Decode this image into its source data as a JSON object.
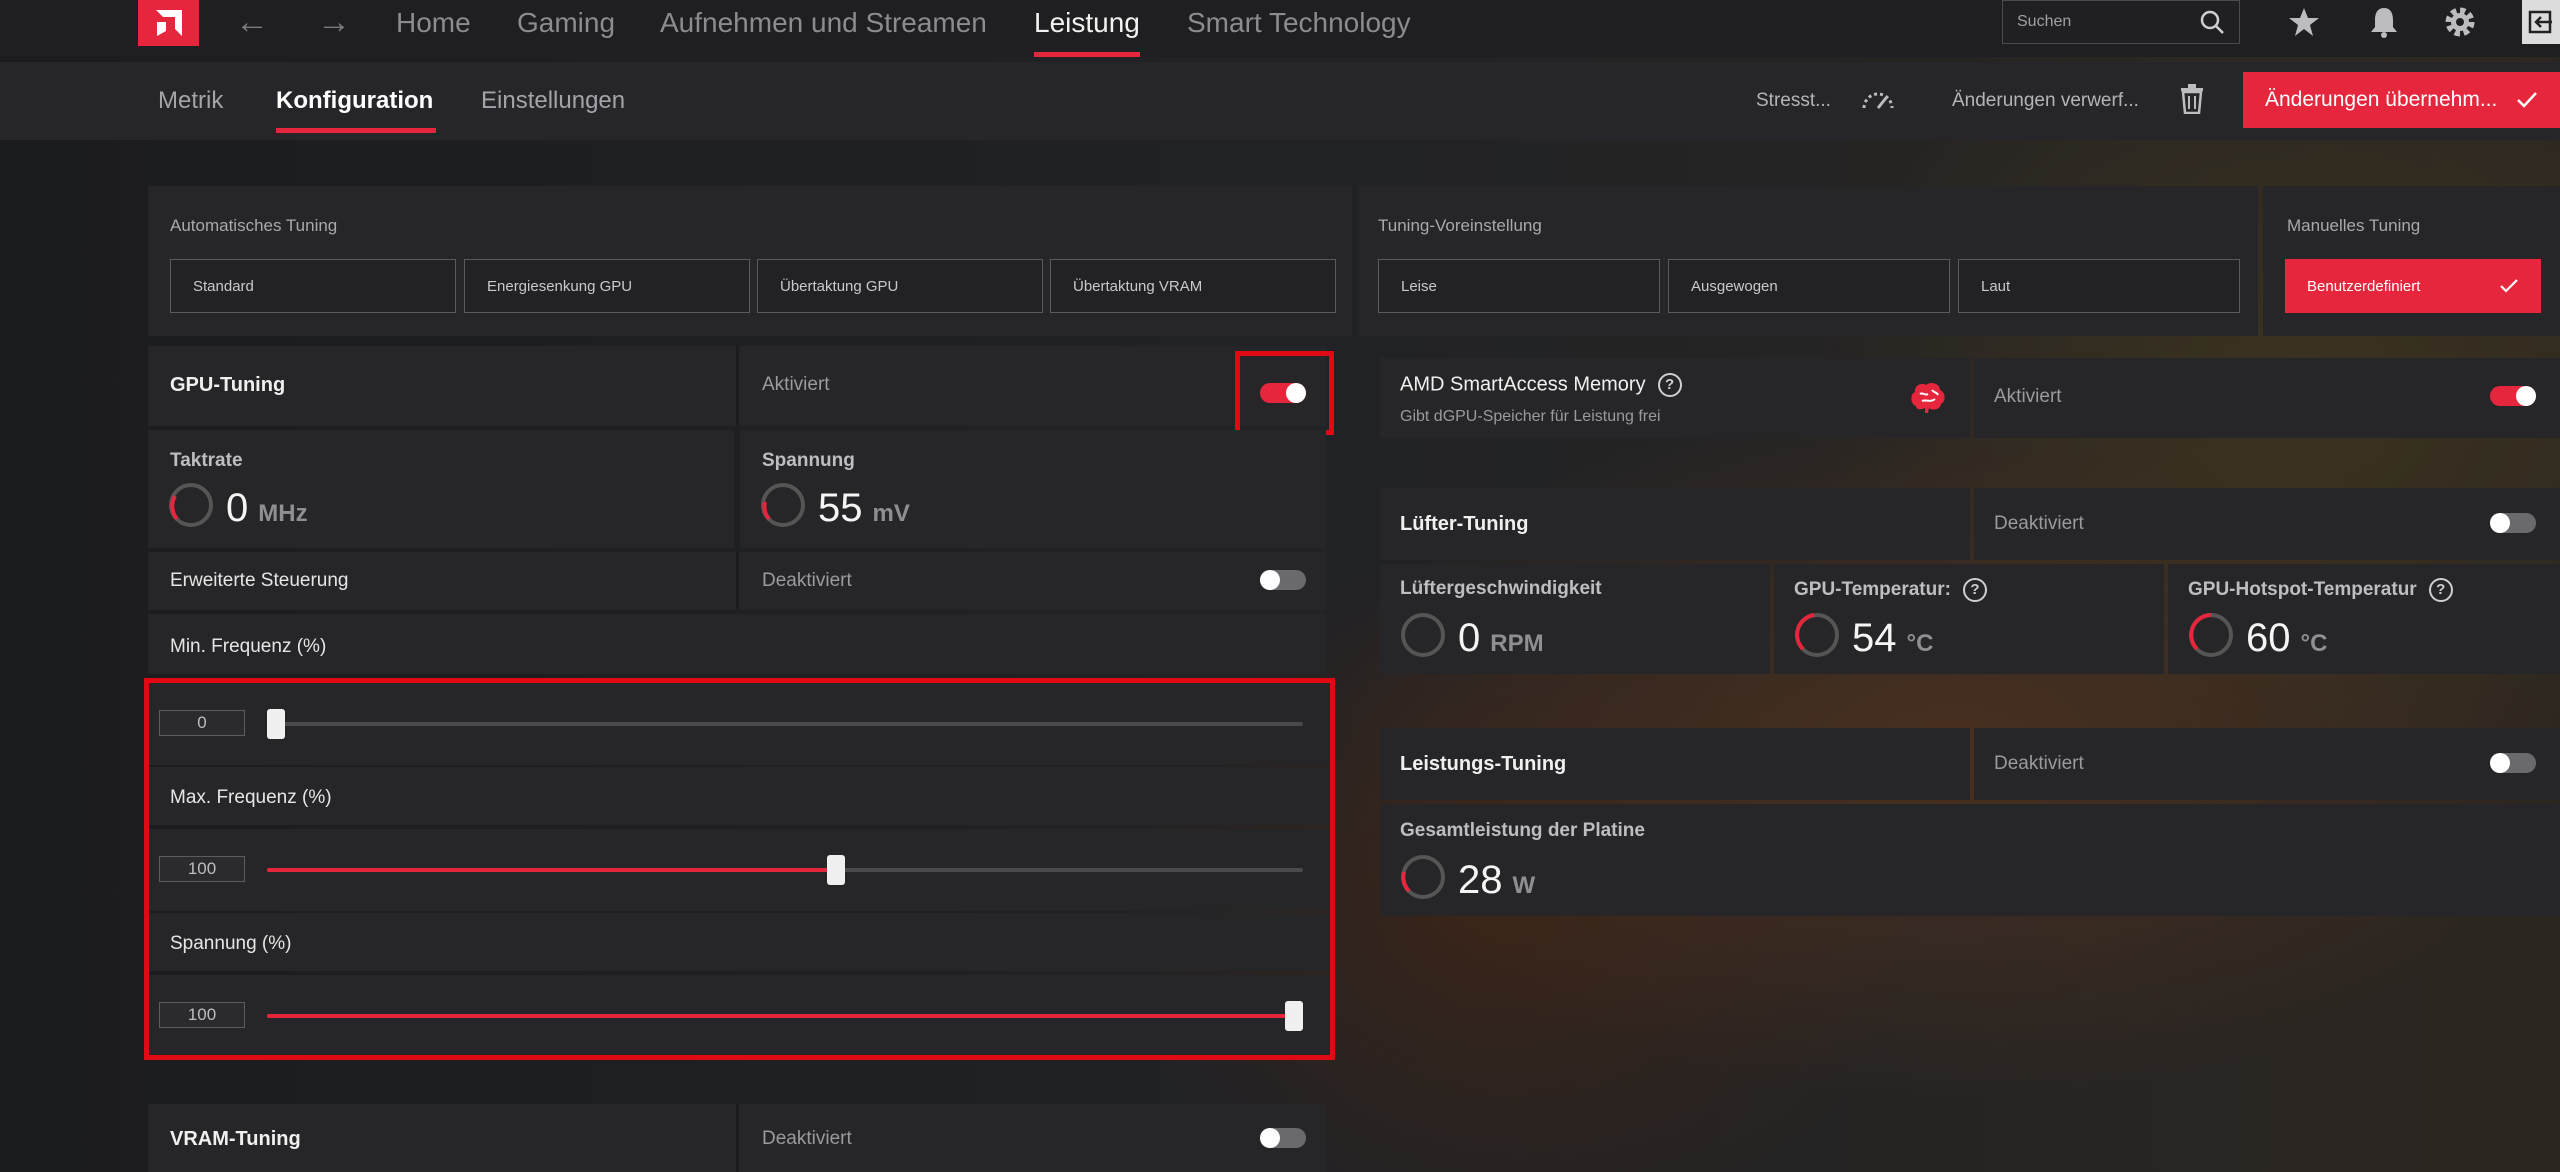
{
  "nav": {
    "tabs": [
      "Home",
      "Gaming",
      "Aufnehmen und Streamen",
      "Leistung",
      "Smart Technology"
    ],
    "active": "Leistung"
  },
  "search": {
    "placeholder": "Suchen"
  },
  "subnav": {
    "tabs": [
      "Metrik",
      "Konfiguration",
      "Einstellungen"
    ],
    "active": "Konfiguration",
    "stress": "Stresst...",
    "discard": "Änderungen verwerf...",
    "apply": "Änderungen übernehm..."
  },
  "auto_tuning": {
    "label": "Automatisches Tuning",
    "buttons": [
      "Standard",
      "Energiesenkung GPU",
      "Übertaktung GPU",
      "Übertaktung VRAM"
    ]
  },
  "preset": {
    "label": "Tuning-Voreinstellung",
    "buttons": [
      "Leise",
      "Ausgewogen",
      "Laut"
    ]
  },
  "manual": {
    "label": "Manuelles Tuning",
    "button": "Benutzerdefiniert"
  },
  "gpu_tuning": {
    "title": "GPU-Tuning",
    "state": "Aktiviert",
    "enabled": true
  },
  "clock": {
    "label": "Taktrate",
    "value": "0",
    "unit": "MHz"
  },
  "voltage": {
    "label": "Spannung",
    "value": "55",
    "unit": "mV"
  },
  "advanced": {
    "label": "Erweiterte Steuerung",
    "state": "Deaktiviert",
    "enabled": false
  },
  "min_freq": {
    "label": "Min. Frequenz (%)",
    "value": "0",
    "level": 0
  },
  "max_freq": {
    "label": "Max. Frequenz (%)",
    "value": "100",
    "level": 55
  },
  "volt_pct": {
    "label": "Spannung (%)",
    "value": "100",
    "level": 100
  },
  "vram": {
    "title": "VRAM-Tuning",
    "state": "Deaktiviert",
    "enabled": false
  },
  "sam": {
    "title": "AMD SmartAccess Memory",
    "subtitle": "Gibt dGPU-Speicher für Leistung frei",
    "state": "Aktiviert",
    "enabled": true
  },
  "fan": {
    "title": "Lüfter-Tuning",
    "state": "Deaktiviert",
    "enabled": false
  },
  "fan_speed": {
    "label": "Lüftergeschwindigkeit",
    "value": "0",
    "unit": "RPM"
  },
  "gpu_temp": {
    "label": "GPU-Temperatur:",
    "value": "54",
    "unit": "°C"
  },
  "hotspot_temp": {
    "label": "GPU-Hotspot-Temperatur",
    "value": "60",
    "unit": "°C"
  },
  "power": {
    "title": "Leistungs-Tuning",
    "state": "Deaktiviert",
    "enabled": false
  },
  "board_power": {
    "label": "Gesamtleistung der Platine",
    "value": "28",
    "unit": "W"
  },
  "colors": {
    "accent": "#e5263c",
    "highlight": "#e00a14"
  }
}
